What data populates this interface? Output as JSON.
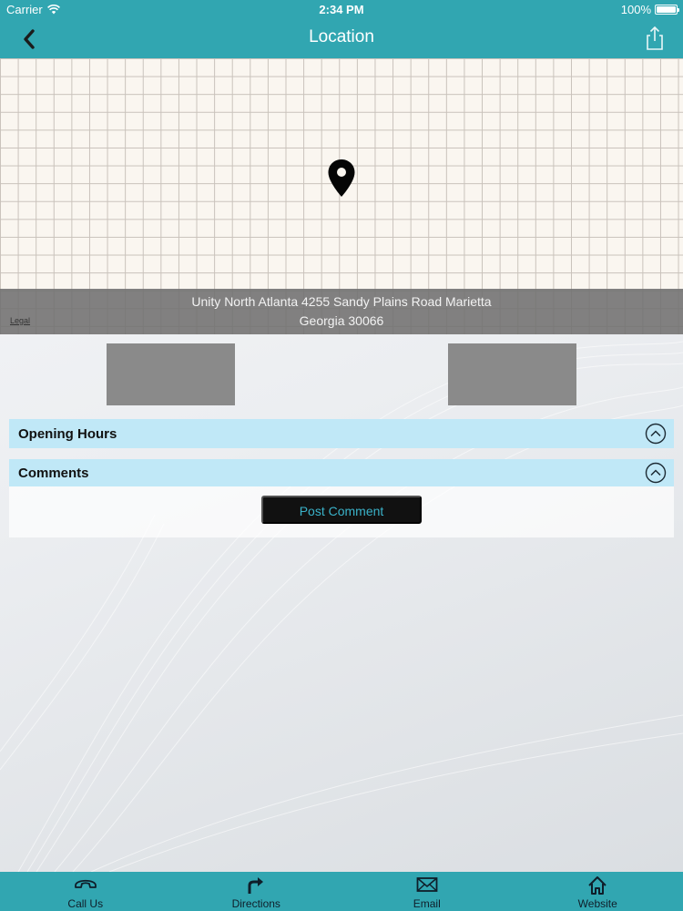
{
  "status_bar": {
    "carrier": "Carrier",
    "time": "2:34 PM",
    "battery": "100%",
    "battery_level": 1.0
  },
  "nav": {
    "title": "Location",
    "back_icon": "chevron-left-icon",
    "share_icon": "share-icon"
  },
  "map": {
    "address_line1": "Unity North Atlanta 4255 Sandy Plains Road Marietta",
    "address_line2": "Georgia 30066",
    "legal": "Legal",
    "pin_icon": "map-pin-icon"
  },
  "sections": {
    "opening_hours": "Opening Hours",
    "comments": "Comments"
  },
  "comments": {
    "post_button": "Post Comment"
  },
  "tabs": [
    {
      "label": "Call Us",
      "icon": "phone-icon"
    },
    {
      "label": "Directions",
      "icon": "directions-arrow-icon"
    },
    {
      "label": "Email",
      "icon": "envelope-icon"
    },
    {
      "label": "Website",
      "icon": "home-icon"
    }
  ],
  "colors": {
    "accent": "#31a6b1",
    "section_header": "#c0e8f7",
    "button_bg": "#111111",
    "button_text": "#3ab2c9"
  }
}
